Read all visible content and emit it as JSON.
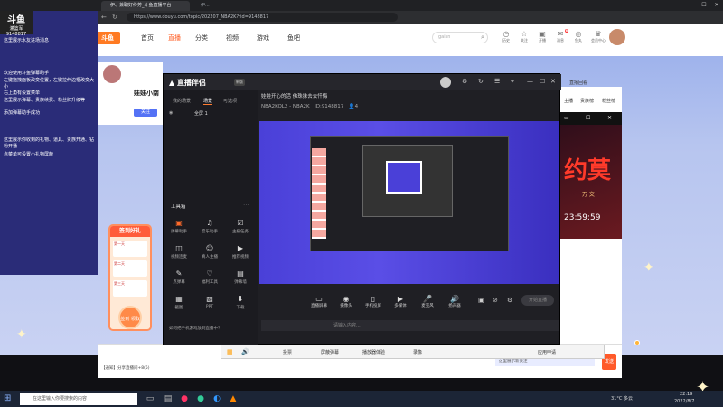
{
  "browser": {
    "tabs": [
      "伊、兼职好伶芳_斗鱼直播平台",
      "伊..."
    ],
    "url": "https://www.douyu.com/topic/202207_NBA2K?rid=9148817"
  },
  "site": {
    "logo": "斗鱼",
    "nav": [
      "首页",
      "直播",
      "分类",
      "视频",
      "游戏",
      "鱼吧"
    ],
    "search_placeholder": "gaisn",
    "nav_icons": [
      {
        "icon": "gift-icon",
        "label": "历史"
      },
      {
        "icon": "star-icon",
        "label": "关注"
      },
      {
        "icon": "broadcast-icon",
        "label": "开播"
      },
      {
        "icon": "mail-icon",
        "label": "消息",
        "badge": "6"
      },
      {
        "icon": "shop-icon",
        "label": "鱼丸"
      },
      {
        "icon": "cart-icon",
        "label": "会员中心"
      }
    ]
  },
  "overlay": {
    "header_name": "灌篮军",
    "room_id": "9148817",
    "lines": [
      "这里展示水友进场消息",
      "欢迎使用斗鱼弹幕助手",
      "左键拖拽面板改变位置，左键拉伸边框改变大小",
      "右上角有设置菜单",
      "这里展示弹幕、贵族续费、粉丝牌升级等",
      "添加弹幕助手成功",
      "这里展示你收到的礼物、道具、贵族开通、钻粉开通",
      "点菜单可设置小礼物屏蔽"
    ]
  },
  "left_room": {
    "title": "娃娃小南",
    "follow": "关注"
  },
  "gift_box": {
    "title": "签到好礼",
    "items": [
      "第一天",
      "第二天",
      "第三天"
    ],
    "button": "签到\n领取"
  },
  "app": {
    "title": "直播伴侣",
    "version": "新版",
    "side_tabs": [
      "我的场景",
      "场景",
      "可选项"
    ],
    "scene": "全屏 1",
    "tool_section": "工具箱",
    "tools": [
      {
        "icon": "gift-icon",
        "label": "弹幕助手",
        "active": true
      },
      {
        "icon": "music-icon",
        "label": "音乐助手"
      },
      {
        "icon": "clipboard-icon",
        "label": "主播任务"
      },
      {
        "icon": "camera-icon",
        "label": "视频连麦"
      },
      {
        "icon": "user-icon",
        "label": "真人主播"
      },
      {
        "icon": "video-icon",
        "label": "推荐视频"
      },
      {
        "icon": "chat-icon",
        "label": "点弹幕"
      },
      {
        "icon": "heart-icon",
        "label": "福利工具"
      },
      {
        "icon": "screen-icon",
        "label": "弹幕墙"
      },
      {
        "icon": "image-icon",
        "label": "截图"
      },
      {
        "icon": "ppt-icon",
        "label": "PPT"
      },
      {
        "icon": "download-icon",
        "label": "下载"
      }
    ],
    "hint": "如何把手机游戏放到直播中？",
    "stream_title": "娃娃开心的活 佛珠抹去去忏悔",
    "stream_tag": "NBA2KOL2 - NBA2K",
    "room_id": "9148817",
    "viewers": "4",
    "controls": [
      {
        "icon": "screen-icon",
        "label": "直播屏幕"
      },
      {
        "icon": "camera-icon",
        "label": "摄像头"
      },
      {
        "icon": "phone-icon",
        "label": "手机投屏"
      },
      {
        "icon": "media-icon",
        "label": "多媒体"
      },
      {
        "icon": "mic-icon",
        "label": "麦克风"
      },
      {
        "icon": "speaker-icon",
        "label": "扬声器"
      }
    ],
    "start_button": "开始直播",
    "chat_placeholder": "请输入内容..."
  },
  "banner": {
    "big_text": "约莫",
    "wan": "万 文",
    "time": "23:59:59",
    "tabs": [
      "主播",
      "贵族榜",
      "粉丝榜"
    ],
    "label": "直播回看"
  },
  "bottom_bar": {
    "items": [
      "投票",
      "屏蔽弹幕",
      "播放器体验",
      "录像"
    ],
    "apply": "应用申请"
  },
  "chat_strip": "【通知】分享直播间+8(5)",
  "taskbar": {
    "search_placeholder": "在这里输入你要搜索的内容",
    "weather": "31°C 多云",
    "time": "22:19",
    "date": "2022/8/7"
  },
  "colors": {
    "accent": "#ff5d23",
    "overlay_bg": "#2a2c78",
    "app_bg": "#1f1f24"
  }
}
